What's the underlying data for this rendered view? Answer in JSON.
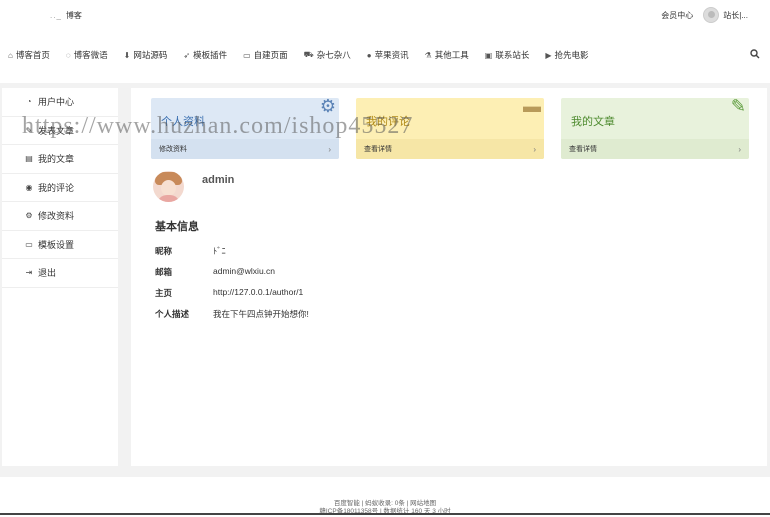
{
  "header": {
    "brand": "博客",
    "brand_mark": ".._",
    "member_center": "会员中心",
    "user_name": "站长|..."
  },
  "nav": {
    "items": [
      {
        "label": "博客首页",
        "icon": "home-icon",
        "glyph": "⌂"
      },
      {
        "label": "博客微语",
        "icon": "chat-icon",
        "glyph": "◌"
      },
      {
        "label": "网站源码",
        "icon": "download-icon",
        "glyph": "⬇"
      },
      {
        "label": "模板插件",
        "icon": "plane-icon",
        "glyph": "➶"
      },
      {
        "label": "自建页面",
        "icon": "folder-icon",
        "glyph": "▭"
      },
      {
        "label": "杂七杂八",
        "icon": "car-icon",
        "glyph": "⛟"
      },
      {
        "label": "苹果资讯",
        "icon": "apple-icon",
        "glyph": "●"
      },
      {
        "label": "其他工具",
        "icon": "flask-icon",
        "glyph": "⚗"
      },
      {
        "label": "联系站长",
        "icon": "contact-card-icon",
        "glyph": "▣"
      },
      {
        "label": "抢先电影",
        "icon": "video-icon",
        "glyph": "▶"
      }
    ]
  },
  "sidebar": {
    "items": [
      {
        "label": "用户中心",
        "icon": "dashboard-icon",
        "glyph": "◔"
      },
      {
        "label": "发表文章",
        "icon": "edit-icon",
        "glyph": "✎"
      },
      {
        "label": "我的文章",
        "icon": "document-icon",
        "glyph": "▤"
      },
      {
        "label": "我的评论",
        "icon": "comments-icon",
        "glyph": "◉"
      },
      {
        "label": "修改资料",
        "icon": "cogs-icon",
        "glyph": "⚙"
      },
      {
        "label": "模板设置",
        "icon": "monitor-icon",
        "glyph": "▭"
      },
      {
        "label": "退出",
        "icon": "sign-out-icon",
        "glyph": "⇥"
      }
    ]
  },
  "cards": [
    {
      "title": "个人资料",
      "foot": "修改资料",
      "arrow": "›",
      "deco": "⚙"
    },
    {
      "title": "我的评论",
      "foot": "查看详情",
      "arrow": "›",
      "deco": "▬"
    },
    {
      "title": "我的文章",
      "foot": "查看详情",
      "arrow": "›",
      "deco": "✎"
    }
  ],
  "profile": {
    "name": "admin",
    "section_title": "基本信息",
    "fields": [
      {
        "label": "昵称",
        "value": "ﾄﾞﾆ"
      },
      {
        "label": "邮箱",
        "value": "admin@wlxiu.cn"
      },
      {
        "label": "主页",
        "value": "http://127.0.0.1/author/1"
      },
      {
        "label": "个人描述",
        "value": "我在下午四点钟开始想你!"
      }
    ]
  },
  "watermark": "https://www.huzhan.com/ishop45527",
  "footer": {
    "line1": "百度智能 | 蚂蚁收录: 0条 | 网站地图",
    "line2": "赣ICP备18011358号 | 数据统计 160 天 3 小时"
  },
  "colors": {
    "card_blue": "#dde8f5",
    "card_yellow": "#fdefb4",
    "card_green": "#e8f2dc",
    "page_bg": "#f2f2f2"
  }
}
